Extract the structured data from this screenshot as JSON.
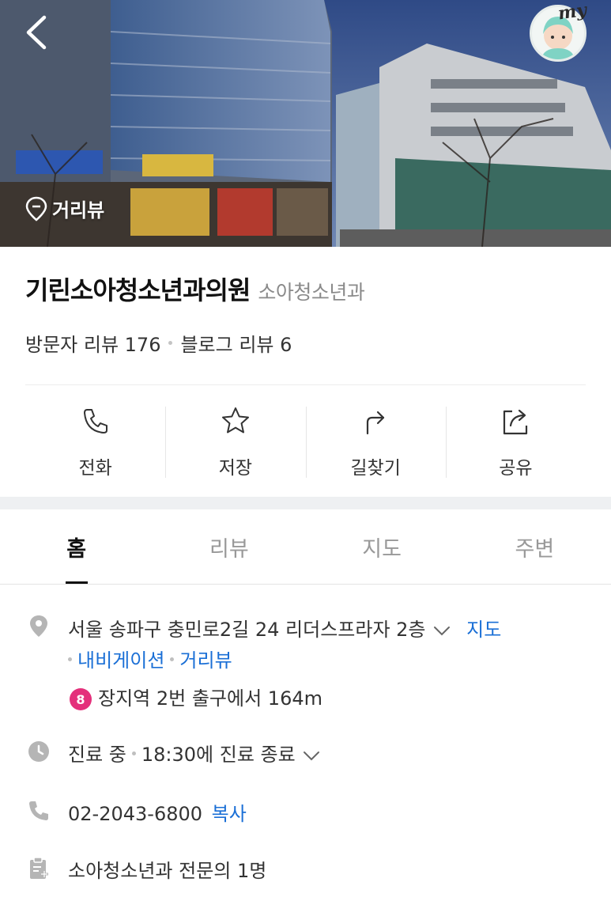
{
  "hero": {
    "streetview_label": "거리뷰",
    "my_label": "my"
  },
  "place": {
    "name": "기린소아청소년과의원",
    "category": "소아청소년과",
    "visitor_reviews": "방문자 리뷰 176",
    "blog_reviews": "블로그 리뷰 6"
  },
  "actions": [
    {
      "label": "전화",
      "icon": "phone-icon"
    },
    {
      "label": "저장",
      "icon": "star-icon"
    },
    {
      "label": "길찾기",
      "icon": "directions-icon"
    },
    {
      "label": "공유",
      "icon": "share-icon"
    }
  ],
  "tabs": [
    {
      "label": "홈",
      "active": true
    },
    {
      "label": "리뷰",
      "active": false
    },
    {
      "label": "지도",
      "active": false
    },
    {
      "label": "주변",
      "active": false
    }
  ],
  "info": {
    "address": "서울 송파구 충민로2길 24 리더스프라자 2층",
    "address_links": {
      "map": "지도",
      "navigation": "내비게이션",
      "streetview": "거리뷰"
    },
    "subway": {
      "line": "8",
      "text": "장지역 2번 출구에서 164m",
      "line_color": "#e4307b"
    },
    "hours_status": "진료 중",
    "hours_detail": "18:30에 진료 종료",
    "phone": "02-2043-6800",
    "phone_copy": "복사",
    "specialists": "소아청소년과 전문의 1명"
  },
  "colors": {
    "link": "#1a6fd6",
    "icon_gray": "#b5b5b5"
  }
}
